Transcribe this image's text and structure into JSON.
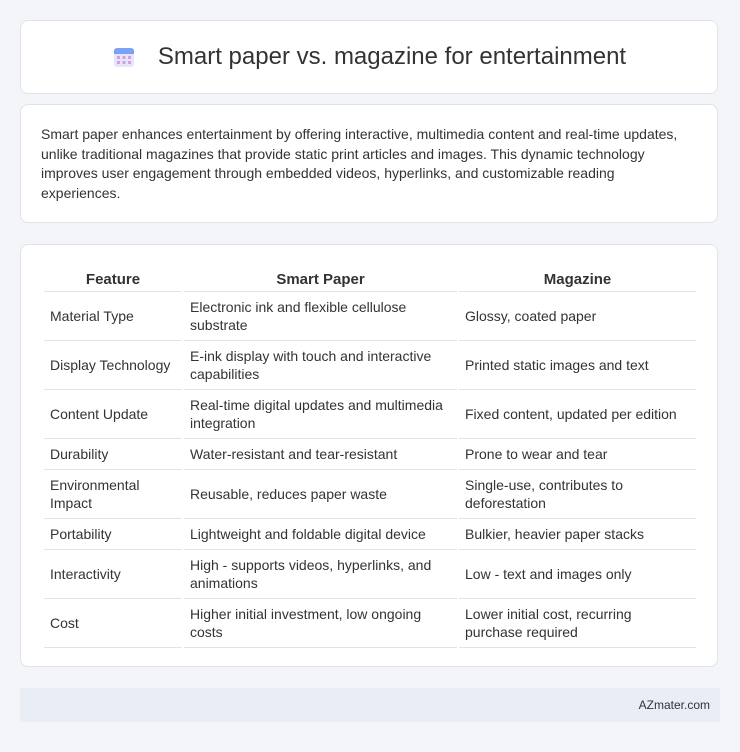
{
  "header": {
    "title": "Smart paper vs. magazine for entertainment",
    "icon": "calendar-icon"
  },
  "intro": "Smart paper enhances entertainment by offering interactive, multimedia content and real-time updates, unlike traditional magazines that provide static print articles and images. This dynamic technology improves user engagement through embedded videos, hyperlinks, and customizable reading experiences.",
  "table": {
    "headers": [
      "Feature",
      "Smart Paper",
      "Magazine"
    ],
    "rows": [
      [
        "Material Type",
        "Electronic ink and flexible cellulose substrate",
        "Glossy, coated paper"
      ],
      [
        "Display Technology",
        "E-ink display with touch and interactive capabilities",
        "Printed static images and text"
      ],
      [
        "Content Update",
        "Real-time digital updates and multimedia integration",
        "Fixed content, updated per edition"
      ],
      [
        "Durability",
        "Water-resistant and tear-resistant",
        "Prone to wear and tear"
      ],
      [
        "Environmental Impact",
        "Reusable, reduces paper waste",
        "Single-use, contributes to deforestation"
      ],
      [
        "Portability",
        "Lightweight and foldable digital device",
        "Bulkier, heavier paper stacks"
      ],
      [
        "Interactivity",
        "High - supports videos, hyperlinks, and animations",
        "Low - text and images only"
      ],
      [
        "Cost",
        "Higher initial investment, low ongoing costs",
        "Lower initial cost, recurring purchase required"
      ]
    ]
  },
  "footer": {
    "credit": "AZmater.com"
  }
}
